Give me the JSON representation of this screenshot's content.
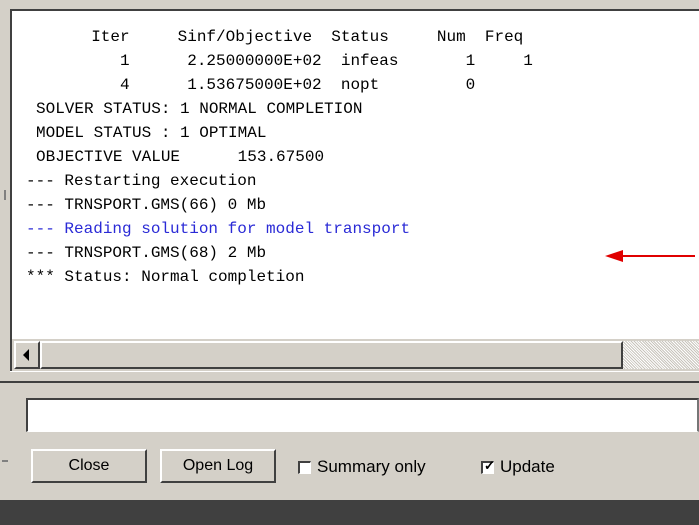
{
  "log": {
    "lines": [
      "  Iter     Sinf/Objective  Status     Num  Freq",
      "     1      2.25000000E+02  infeas       1     1",
      "     4      1.53675000E+02  nopt         0",
      "SOLVER STATUS: 1 NORMAL COMPLETION",
      "MODEL STATUS : 1 OPTIMAL",
      "OBJECTIVE VALUE      153.67500",
      "--- Restarting execution",
      "--- TRNSPORT.GMS(66) 0 Mb",
      "--- Reading solution for model transport",
      "--- TRNSPORT.GMS(68) 2 Mb",
      "*** Status: Normal completion"
    ],
    "highlight_color": "#2a2ad6",
    "arrow_color": "#e00000"
  },
  "command": {
    "value": ""
  },
  "buttons": {
    "close_label": "Close",
    "open_log_label": "Open Log"
  },
  "options": {
    "summary_label": "Summary only",
    "summary_checked": false,
    "update_label": "Update",
    "update_checked": true
  }
}
